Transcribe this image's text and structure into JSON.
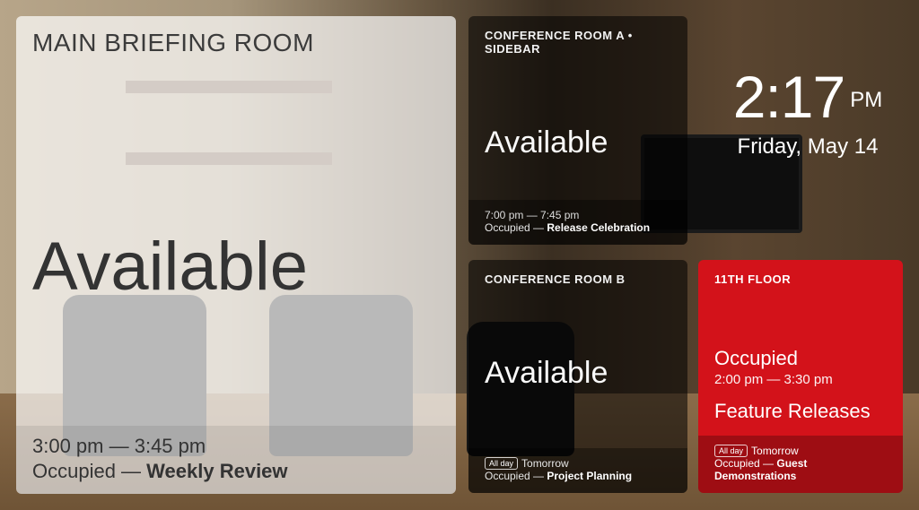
{
  "clock": {
    "time": "2:17",
    "ampm": "PM",
    "date": "Friday, May 14"
  },
  "main": {
    "name": "MAIN BRIEFING ROOM",
    "status": "Available",
    "next_time": "3:00 pm — 3:45 pm",
    "next_prefix": "Occupied — ",
    "next_event": "Weekly Review"
  },
  "rooms": [
    {
      "name": "CONFERENCE ROOM A • SIDEBAR",
      "status": "Available",
      "next_time": "7:00 pm — 7:45 pm",
      "next_prefix": "Occupied — ",
      "next_event": "Release Celebration"
    },
    {
      "name": "CONFERENCE ROOM B",
      "status": "Available",
      "badge": "All day",
      "next_time": "Tomorrow",
      "next_prefix": "Occupied — ",
      "next_event": "Project Planning"
    },
    {
      "name": "11TH FLOOR",
      "status": "Occupied",
      "current_time": "2:00 pm — 3:30 pm",
      "current_event": "Feature Releases",
      "badge": "All day",
      "next_time": "Tomorrow",
      "next_prefix": "Occupied — ",
      "next_event": "Guest Demonstrations"
    }
  ]
}
